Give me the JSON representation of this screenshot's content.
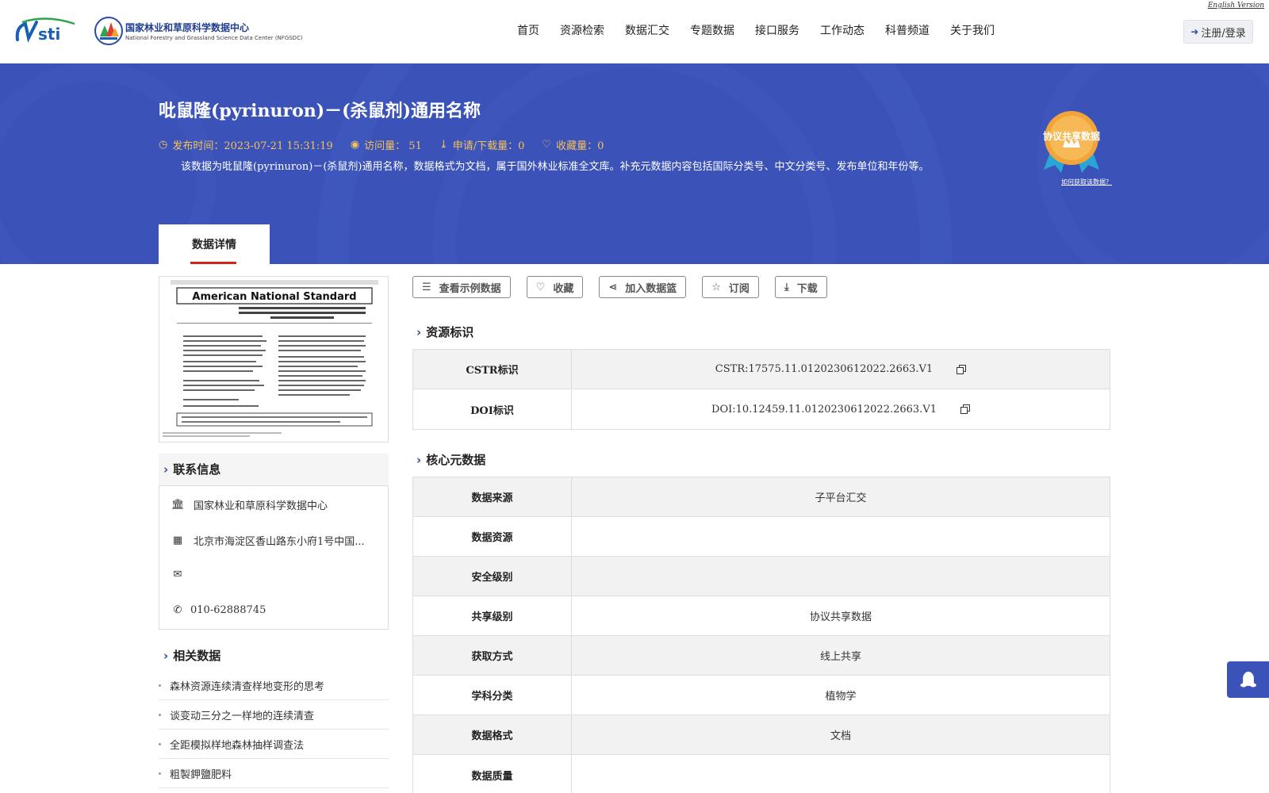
{
  "header": {
    "english_link": "English Version",
    "center_name": "国家林业和草原科学数据中心",
    "center_name_en": "National Forestry and Grassland Science Data Center (NFGSDC)",
    "nav": [
      "首页",
      "资源检索",
      "数据汇交",
      "专题数据",
      "接口服务",
      "工作动态",
      "科普频道",
      "关于我们"
    ],
    "login_label": "注册/登录"
  },
  "banner": {
    "title": "吡鼠隆(pyrinuron)－(杀鼠剂)通用名称",
    "publish_time": "发布时间：2023-07-21 15:31:19",
    "visits": "访问量： 51",
    "downloads": "申请/下载量：0",
    "favorites": "收藏量：0",
    "description": "该数据为吡鼠隆(pyrinuron)－(杀鼠剂)通用名称，数据格式为文档，属于国外林业标准全文库。补充元数据内容包括国际分类号、中文分类号、发布单位和年份等。",
    "badge_text": "协议共享数据",
    "badge_link": "如何获取该数据？",
    "tab_label": "数据详情"
  },
  "contact": {
    "title": "联系信息",
    "org": "国家林业和草原科学数据中心",
    "address": "北京市海淀区香山路东小府1号中国...",
    "email": "",
    "phone": "010-62888745"
  },
  "related": {
    "title": "相关数据",
    "items": [
      "森林资源连续清查样地变形的思考",
      "谈变动三分之一样地的连续清查",
      "全距模拟样地森林抽样调查法",
      "粗製鉀鹽肥料"
    ]
  },
  "actions": {
    "sample": "查看示例数据",
    "favorite": "收藏",
    "basket": "加入数据篮",
    "subscribe": "订阅",
    "download": "下载"
  },
  "resource_id": {
    "title": "资源标识",
    "rows": [
      {
        "key": "CSTR标识",
        "value": "CSTR:17575.11.0120230612022.2663.V1"
      },
      {
        "key": "DOI标识",
        "value": "DOI:10.12459.11.0120230612022.2663.V1"
      }
    ]
  },
  "core_meta": {
    "title": "核心元数据",
    "rows": [
      {
        "key": "数据来源",
        "value": "子平台汇交"
      },
      {
        "key": "数据资源",
        "value": ""
      },
      {
        "key": "安全级别",
        "value": ""
      },
      {
        "key": "共享级别",
        "value": "协议共享数据"
      },
      {
        "key": "获取方式",
        "value": "线上共享"
      },
      {
        "key": "学科分类",
        "value": "植物学"
      },
      {
        "key": "数据格式",
        "value": "文档"
      },
      {
        "key": "数据质量",
        "value": ""
      }
    ]
  },
  "thumbnail": {
    "doc_title": "American National Standard",
    "doc_subtitle": "common name for the pest control chemical N-(4-nitrophenyl)-N'-(3-pyridinylmethyl)urea \"pyrinuron\""
  },
  "colors": {
    "banner": "#3b52b8",
    "accent_gold": "#f3c35a",
    "brand_blue": "#2c4aa9",
    "tab_underline": "#d0261c"
  }
}
